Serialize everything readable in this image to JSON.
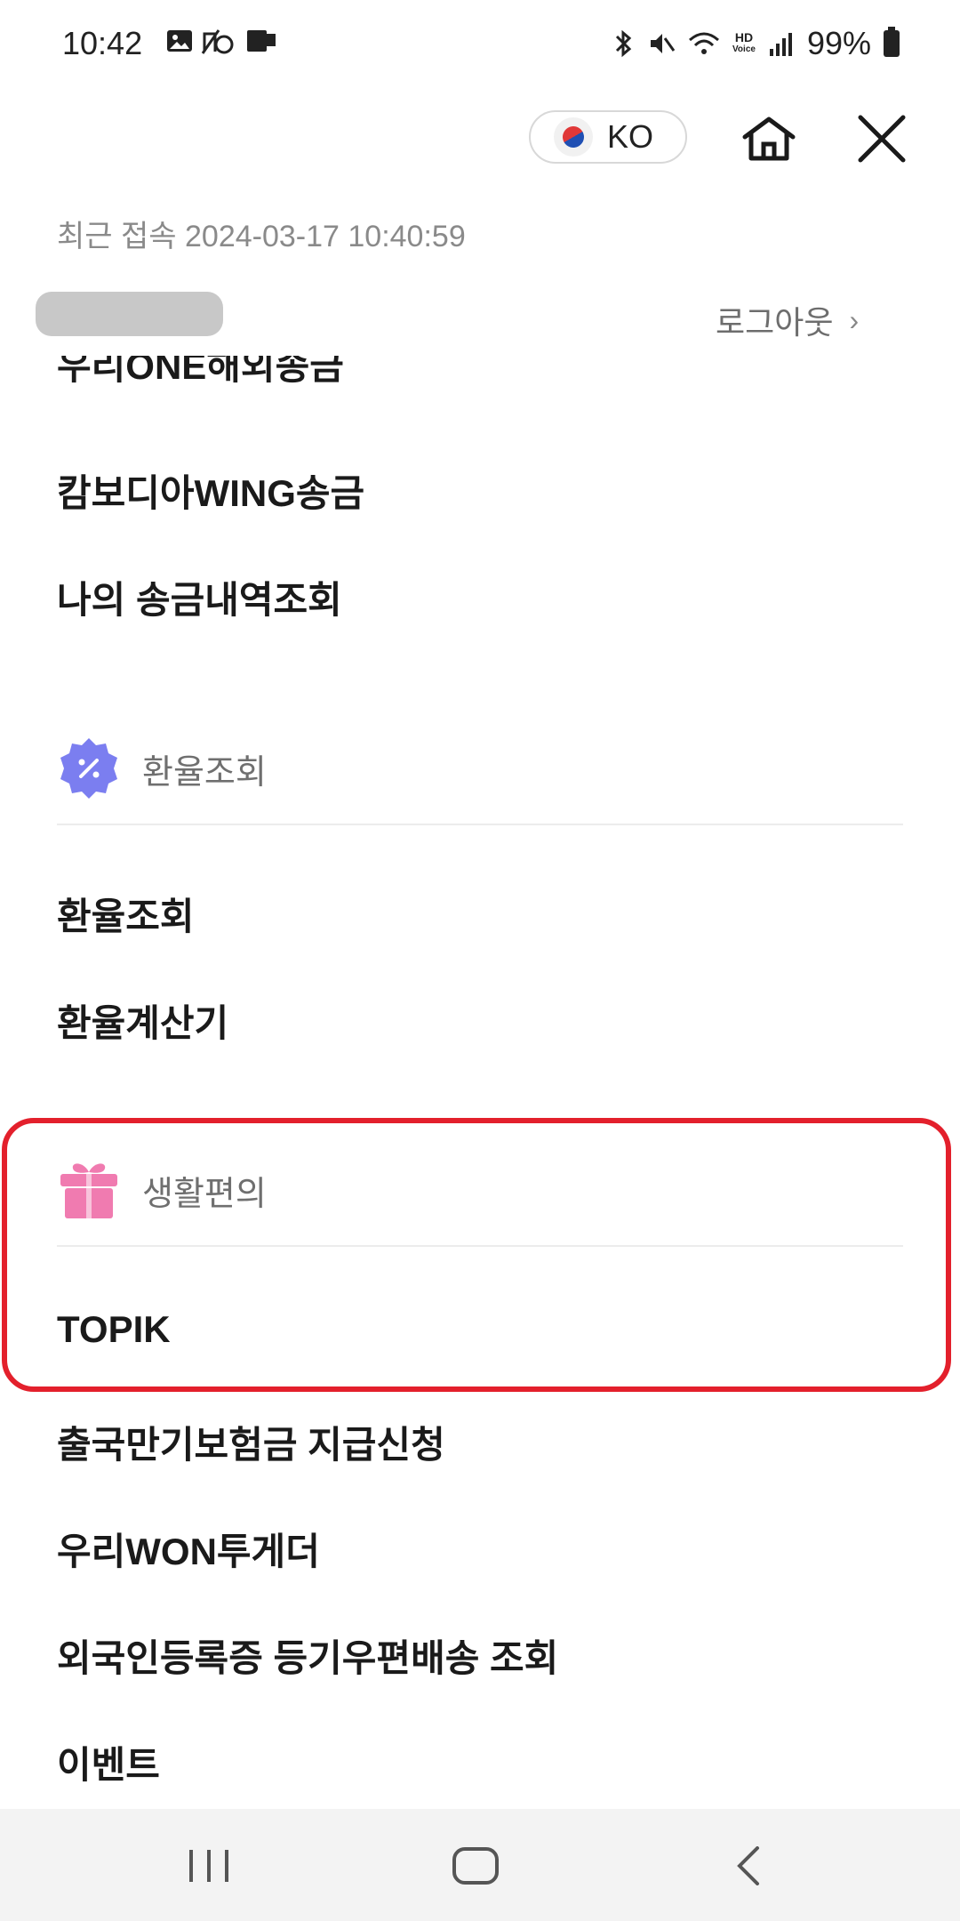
{
  "status_bar": {
    "time": "10:42",
    "battery": "99%",
    "hd_top": "HD",
    "hd_bottom": "Voice",
    "left_icons": [
      "image-icon",
      "no-sound-alarm-icon",
      "notification-icon"
    ],
    "right_icons": [
      "bluetooth-icon",
      "mute-icon",
      "wifi-icon",
      "hd-voice-icon",
      "signal-icon",
      "battery-icon"
    ]
  },
  "header": {
    "language": "KO",
    "flag": "korea-flag-icon"
  },
  "account": {
    "last_login": "최근 접속 2024-03-17 10:40:59",
    "logout": "로그아웃"
  },
  "menu": {
    "cut_off_item": "우리ONE해외송금",
    "remit_items": [
      "캄보디아WING송금",
      "나의 송금내역조회"
    ],
    "exchange_section": "환율조회",
    "exchange_items": [
      "환율조회",
      "환율계산기"
    ],
    "life_section": "생활편의",
    "life_items": [
      "TOPIK",
      "출국만기보험금 지급신청",
      "우리WON투게더",
      "외국인등록증 등기우편배송 조회",
      "이벤트"
    ]
  },
  "colors": {
    "highlight": "#e3202c",
    "exchange_icon": "#7b7ef0",
    "gift_icon": "#f07bb0"
  }
}
